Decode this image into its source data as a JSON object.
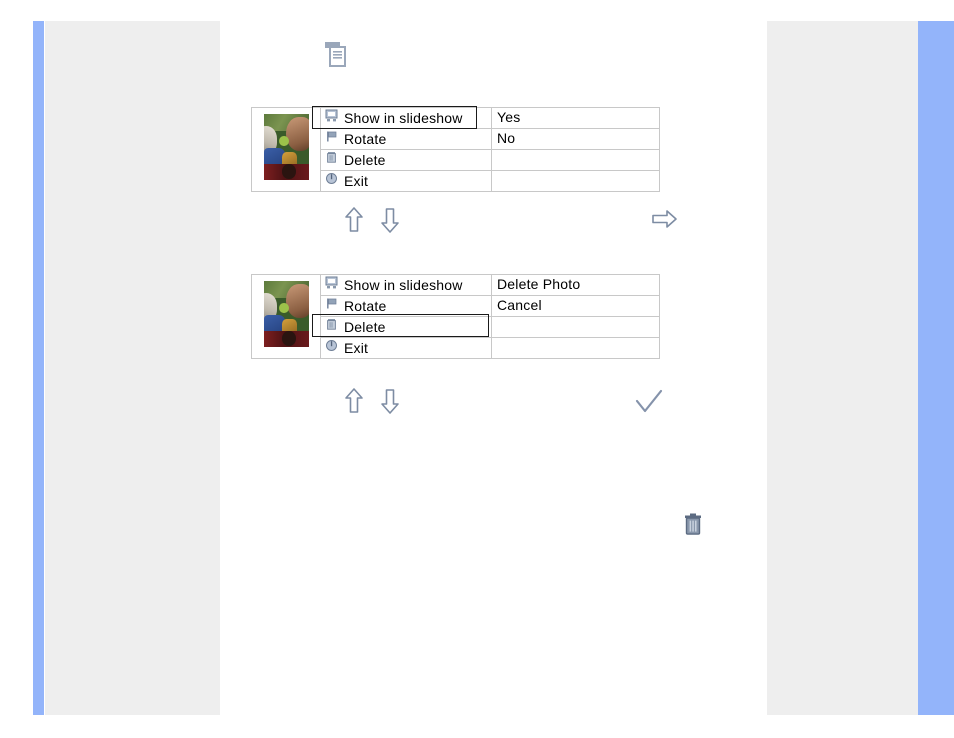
{
  "page": {
    "background": "#ffffff",
    "accent_blue": "#93b4fa",
    "panel_gray": "#eeeeee",
    "icon_gray": "#7e8da4"
  },
  "header_icon": {
    "name": "document-list-icon",
    "color": "#8b99ae"
  },
  "menus": [
    {
      "id": "slideshow-menu",
      "thumbnail_alt": "photo thumbnail",
      "selected_index": 0,
      "items": [
        {
          "label": "Show in slideshow",
          "icon": "monitor-icon"
        },
        {
          "label": "Rotate",
          "icon": "flag-icon"
        },
        {
          "label": "Delete",
          "icon": "trash-icon"
        },
        {
          "label": "Exit",
          "icon": "power-icon"
        }
      ],
      "options": [
        "Yes",
        "No",
        "",
        ""
      ],
      "nav": {
        "up": "arrow-up",
        "down": "arrow-down",
        "action": "arrow-right"
      }
    },
    {
      "id": "delete-menu",
      "thumbnail_alt": "photo thumbnail",
      "selected_index": 2,
      "items": [
        {
          "label": "Show in slideshow",
          "icon": "monitor-icon"
        },
        {
          "label": "Rotate",
          "icon": "flag-icon"
        },
        {
          "label": "Delete",
          "icon": "trash-icon"
        },
        {
          "label": "Exit",
          "icon": "power-icon"
        }
      ],
      "options": [
        "Delete Photo",
        "Cancel",
        "",
        ""
      ],
      "nav": {
        "up": "arrow-up",
        "down": "arrow-down",
        "action": "checkmark"
      }
    }
  ],
  "footer_icon": {
    "name": "trash-icon",
    "color": "#5c6b82"
  }
}
